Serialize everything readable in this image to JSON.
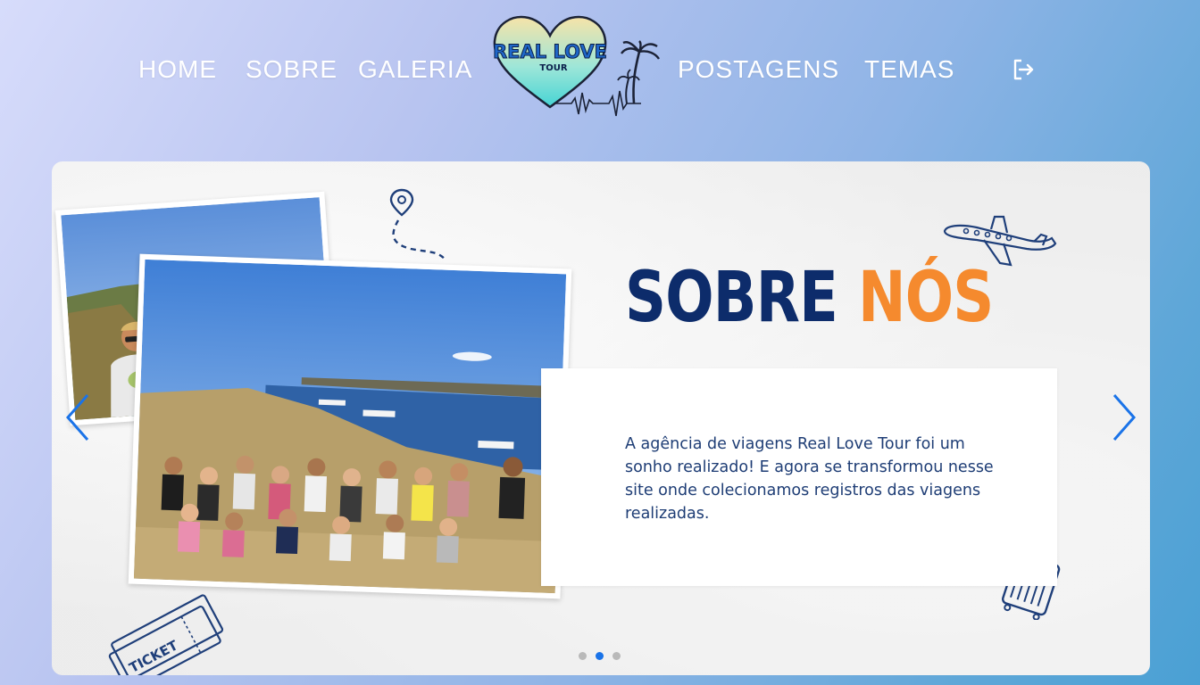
{
  "nav": {
    "links": [
      "HOME",
      "SOBRE",
      "GALERIA",
      "POSTAGENS",
      "TEMAS"
    ],
    "logo": {
      "line1": "REAL LOVE",
      "line2": "TOUR"
    },
    "logout_icon": "logout-icon"
  },
  "carousel": {
    "title_part1": "SOBRE",
    "title_part2": "NÓS",
    "body": "A agência de viagens Real Love Tour foi um sonho realizado! E agora se transformou nesse site onde colecionamos registros das viagens realizadas.",
    "ticket_text": "TICKET",
    "prev_icon": "chevron-left-icon",
    "next_icon": "chevron-right-icon",
    "active_slide": 2,
    "slide_count": 3,
    "colors": {
      "title_dark": "#0d2c6b",
      "title_accent": "#f58a2e",
      "text": "#1e3d75",
      "arrow": "#1a73e8"
    }
  }
}
